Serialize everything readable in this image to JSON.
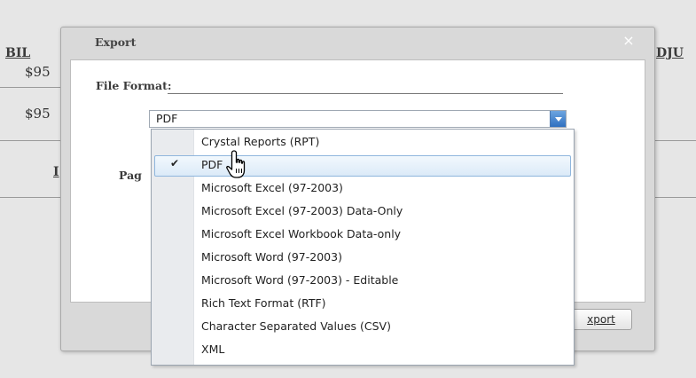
{
  "background": {
    "col_left_header": "BIL",
    "col_right_header": "DJU",
    "amount_1": "$95",
    "amount_2": "$95",
    "partial_mark": "I"
  },
  "dialog": {
    "title": "Export",
    "close_glyph": "×",
    "file_format_label": "File Format:",
    "page_label": "Pag",
    "selected_format": "PDF",
    "export_button_label": "xport"
  },
  "dropdown": {
    "options": [
      {
        "label": "Crystal Reports (RPT)",
        "selected": false
      },
      {
        "label": "PDF",
        "selected": true
      },
      {
        "label": "Microsoft Excel (97-2003)",
        "selected": false
      },
      {
        "label": "Microsoft Excel (97-2003) Data-Only",
        "selected": false
      },
      {
        "label": "Microsoft Excel Workbook Data-only",
        "selected": false
      },
      {
        "label": "Microsoft Word (97-2003)",
        "selected": false
      },
      {
        "label": "Microsoft Word (97-2003) - Editable",
        "selected": false
      },
      {
        "label": "Rich Text Format (RTF)",
        "selected": false
      },
      {
        "label": "Character Separated Values (CSV)",
        "selected": false
      },
      {
        "label": "XML",
        "selected": false
      }
    ],
    "check_glyph": "✔"
  },
  "colors": {
    "accent": "#2f6fc0",
    "selection_border": "#8fb6dd"
  },
  "icons": {
    "cursor": "hand-pointer-icon",
    "check": "check-icon",
    "close": "close-icon",
    "dropdown_arrow": "chevron-down-icon"
  }
}
